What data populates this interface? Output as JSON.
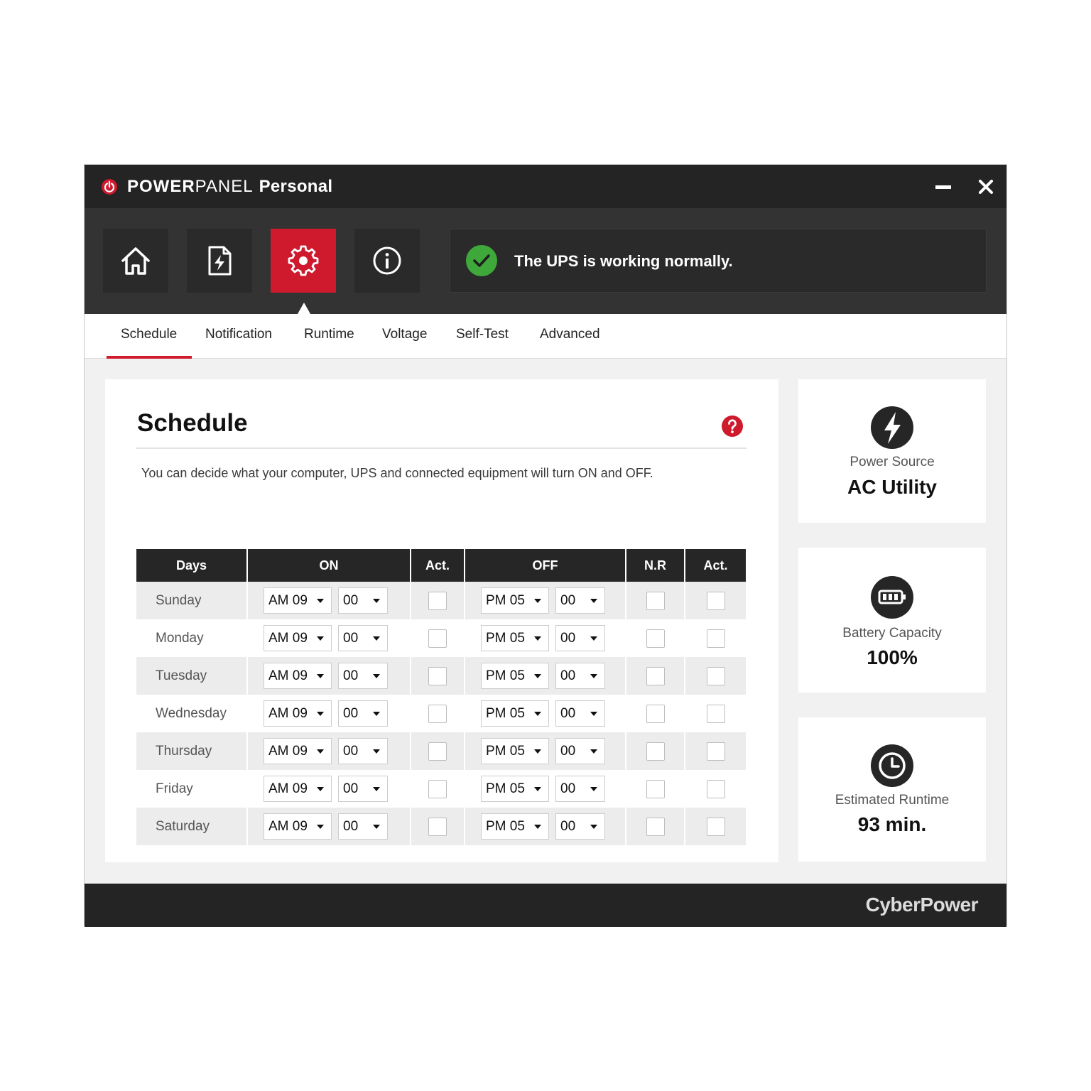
{
  "app": {
    "title_bold": "POWER",
    "title_light": "PANEL",
    "title_suffix": "Personal"
  },
  "nav": [
    {
      "name": "home",
      "icon": "home-icon"
    },
    {
      "name": "status",
      "icon": "power-document-icon"
    },
    {
      "name": "settings",
      "icon": "gear-icon",
      "active": true
    },
    {
      "name": "about",
      "icon": "info-icon"
    }
  ],
  "status": {
    "message": "The UPS is working normally.",
    "icon": "check-circle-icon",
    "color": "#3ea83a"
  },
  "tabs": [
    "Schedule",
    "Notification",
    "Runtime",
    "Voltage",
    "Self-Test",
    "Advanced"
  ],
  "active_tab": "Schedule",
  "schedule": {
    "title": "Schedule",
    "description": "You can decide what your computer, UPS and connected equipment will turn ON and OFF.",
    "headers": [
      "Days",
      "ON",
      "Act.",
      "OFF",
      "N.R",
      "Act."
    ],
    "rows": [
      {
        "day": "Sunday",
        "on_hour": "AM 09",
        "on_min": "00",
        "on_act": false,
        "off_hour": "PM 05",
        "off_min": "00",
        "nr": false,
        "off_act": false
      },
      {
        "day": "Monday",
        "on_hour": "AM 09",
        "on_min": "00",
        "on_act": false,
        "off_hour": "PM 05",
        "off_min": "00",
        "nr": false,
        "off_act": false
      },
      {
        "day": "Tuesday",
        "on_hour": "AM 09",
        "on_min": "00",
        "on_act": false,
        "off_hour": "PM 05",
        "off_min": "00",
        "nr": false,
        "off_act": false
      },
      {
        "day": "Wednesday",
        "on_hour": "AM 09",
        "on_min": "00",
        "on_act": false,
        "off_hour": "PM 05",
        "off_min": "00",
        "nr": false,
        "off_act": false
      },
      {
        "day": "Thursday",
        "on_hour": "AM 09",
        "on_min": "00",
        "on_act": false,
        "off_hour": "PM 05",
        "off_min": "00",
        "nr": false,
        "off_act": false
      },
      {
        "day": "Friday",
        "on_hour": "AM 09",
        "on_min": "00",
        "on_act": false,
        "off_hour": "PM 05",
        "off_min": "00",
        "nr": false,
        "off_act": false
      },
      {
        "day": "Saturday",
        "on_hour": "AM 09",
        "on_min": "00",
        "on_act": false,
        "off_hour": "PM 05",
        "off_min": "00",
        "nr": false,
        "off_act": false
      }
    ]
  },
  "side": {
    "power_source": {
      "label": "Power Source",
      "value": "AC Utility",
      "icon": "lightning-icon"
    },
    "battery": {
      "label": "Battery Capacity",
      "value": "100%",
      "icon": "battery-icon"
    },
    "runtime": {
      "label": "Estimated Runtime",
      "value": "93 min.",
      "icon": "clock-icon"
    }
  },
  "footer": {
    "brand": "CyberPower"
  },
  "colors": {
    "accent": "#cf1a2e",
    "dark": "#242424",
    "toolbar": "#333333",
    "ok": "#3ea83a"
  }
}
